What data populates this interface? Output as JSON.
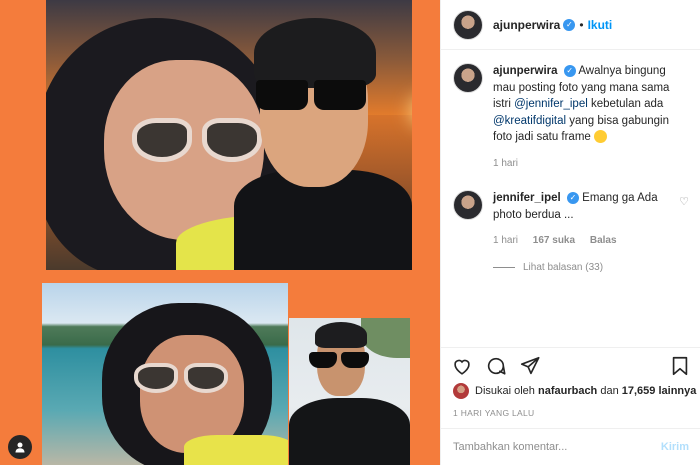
{
  "post": {
    "author": "ajunperwira",
    "separator": "•",
    "follow_label": "Ikuti",
    "caption": {
      "username": "ajunperwira",
      "text_1": "Awalnya bingung mau posting foto yang mana sama istri",
      "mention_1": "@jennifer_ipel",
      "text_2": "kebetulan ada",
      "mention_2": "@kreatifdigital",
      "text_3": "yang bisa gabungin foto jadi satu frame",
      "time": "1 hari"
    },
    "comments": [
      {
        "username": "jennifer_ipel",
        "text": "Emang ga Ada photo berdua ...",
        "time": "1 hari",
        "likes": "167 suka",
        "reply_label": "Balas",
        "view_replies": "Lihat balasan (33)"
      }
    ],
    "likes_line": {
      "prefix": "Disukai oleh",
      "user": "nafaurbach",
      "conj": "dan",
      "count": "17,659 lainnya"
    },
    "date": "1 HARI YANG LALU",
    "comment_input": {
      "placeholder": "Tambahkan komentar...",
      "post_label": "Kirim"
    }
  },
  "icons": {
    "verified": "verified-badge-icon",
    "heart": "heart-icon",
    "comment": "comment-icon",
    "share": "share-icon",
    "save": "bookmark-icon",
    "user_tag": "user-tag-icon"
  },
  "colors": {
    "accent": "#0095f6",
    "photo_bg": "#f47c3c",
    "verified": "#3897f0"
  }
}
